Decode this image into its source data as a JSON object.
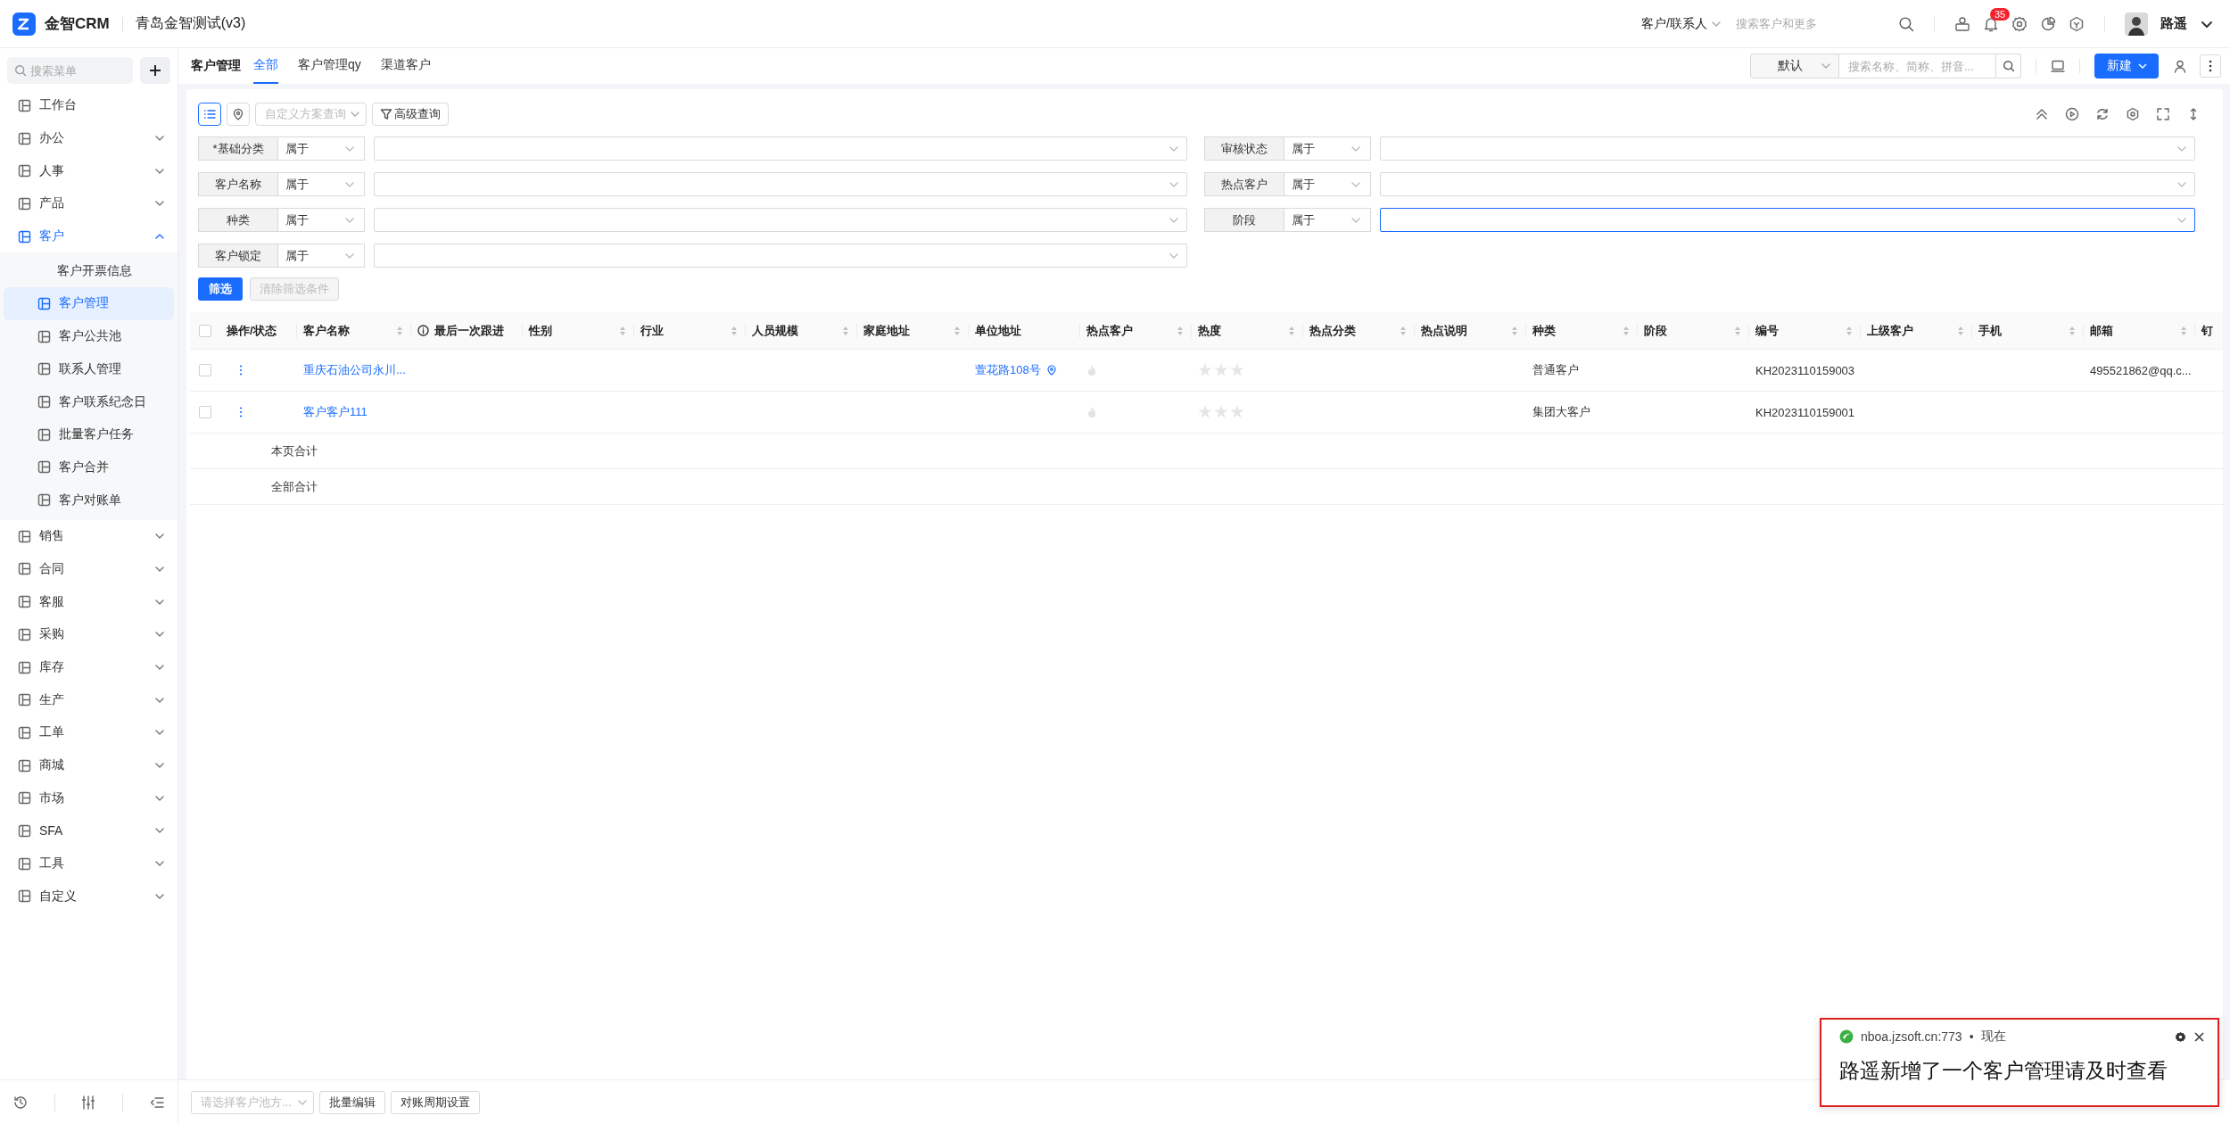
{
  "app": {
    "logo_text": "金智CRM",
    "org_name": "青岛金智测试(v3)"
  },
  "header": {
    "search_scope": "客户/联系人",
    "search_placeholder": "搜索客户和更多",
    "notification_count": "35",
    "user_name": "路遥"
  },
  "sidebar": {
    "search_placeholder": "搜索菜单",
    "items": [
      {
        "label": "工作台",
        "kind": "link",
        "selected": false
      },
      {
        "label": "办公",
        "kind": "group",
        "expanded": false,
        "selected": false
      },
      {
        "label": "人事",
        "kind": "group",
        "expanded": false,
        "selected": false
      },
      {
        "label": "产品",
        "kind": "group",
        "expanded": false,
        "selected": false
      },
      {
        "label": "客户",
        "kind": "group",
        "expanded": true,
        "selected": true,
        "children": [
          {
            "label": "客户开票信息",
            "kind": "plain",
            "selected": false
          },
          {
            "label": "客户管理",
            "kind": "page",
            "selected": true
          },
          {
            "label": "客户公共池",
            "kind": "page",
            "selected": false
          },
          {
            "label": "联系人管理",
            "kind": "page",
            "selected": false
          },
          {
            "label": "客户联系纪念日",
            "kind": "page",
            "selected": false
          },
          {
            "label": "批量客户任务",
            "kind": "page",
            "selected": false
          },
          {
            "label": "客户合并",
            "kind": "page",
            "selected": false
          },
          {
            "label": "客户对账单",
            "kind": "page",
            "selected": false
          }
        ]
      },
      {
        "label": "销售",
        "kind": "group",
        "expanded": false,
        "selected": false
      },
      {
        "label": "合同",
        "kind": "group",
        "expanded": false,
        "selected": false
      },
      {
        "label": "客服",
        "kind": "group",
        "expanded": false,
        "selected": false
      },
      {
        "label": "采购",
        "kind": "group",
        "expanded": false,
        "selected": false
      },
      {
        "label": "库存",
        "kind": "group",
        "expanded": false,
        "selected": false
      },
      {
        "label": "生产",
        "kind": "group",
        "expanded": false,
        "selected": false
      },
      {
        "label": "工单",
        "kind": "group",
        "expanded": false,
        "selected": false
      },
      {
        "label": "商城",
        "kind": "group",
        "expanded": false,
        "selected": false
      },
      {
        "label": "市场",
        "kind": "group",
        "expanded": false,
        "selected": false
      },
      {
        "label": "SFA",
        "kind": "group",
        "expanded": false,
        "selected": false
      },
      {
        "label": "工具",
        "kind": "group",
        "expanded": false,
        "selected": false
      },
      {
        "label": "自定义",
        "kind": "group",
        "expanded": false,
        "selected": false
      }
    ]
  },
  "page": {
    "title": "客户管理",
    "tabs": [
      {
        "label": "全部",
        "selected": true
      },
      {
        "label": "客户管理qy",
        "selected": false
      },
      {
        "label": "渠道客户",
        "selected": false
      }
    ],
    "view_select": "默认",
    "search_placeholder": "搜索名称、简称、拼音...",
    "new_button": "新建"
  },
  "toolbar": {
    "views": [
      {
        "kind": "list",
        "selected": true
      },
      {
        "kind": "map",
        "selected": false
      }
    ],
    "scheme_placeholder": "自定义方案查询",
    "advanced_button": "高级查询"
  },
  "filters": [
    {
      "label": "*基础分类",
      "operator": "属于",
      "focused": false
    },
    {
      "label": "审核状态",
      "operator": "属于",
      "focused": false
    },
    {
      "label": "客户名称",
      "operator": "属于",
      "focused": false
    },
    {
      "label": "热点客户",
      "operator": "属于",
      "focused": false
    },
    {
      "label": "种类",
      "operator": "属于",
      "focused": false
    },
    {
      "label": "阶段",
      "operator": "属于",
      "focused": true
    },
    {
      "label": "客户锁定",
      "operator": "属于",
      "focused": false
    }
  ],
  "filter_buttons": {
    "apply": "筛选",
    "clear": "清除筛选条件",
    "clear_disabled": true
  },
  "table": {
    "select_all_checked": false,
    "columns": [
      {
        "label": "操作/状态",
        "kind": "actions",
        "sortable": false
      },
      {
        "label": "客户名称",
        "kind": "name",
        "sortable": true
      },
      {
        "label": "最后一次跟进",
        "kind": "plain",
        "sortable": false,
        "info": true
      },
      {
        "label": "性别",
        "kind": "plain",
        "sortable": true
      },
      {
        "label": "行业",
        "kind": "plain",
        "sortable": true
      },
      {
        "label": "人员规模",
        "kind": "plain",
        "sortable": true
      },
      {
        "label": "家庭地址",
        "kind": "plain",
        "sortable": true
      },
      {
        "label": "单位地址",
        "kind": "address",
        "sortable": false
      },
      {
        "label": "热点客户",
        "kind": "hot",
        "sortable": true
      },
      {
        "label": "热度",
        "kind": "stars",
        "sortable": true
      },
      {
        "label": "热点分类",
        "kind": "plain",
        "sortable": true
      },
      {
        "label": "热点说明",
        "kind": "plain",
        "sortable": true
      },
      {
        "label": "种类",
        "kind": "type",
        "sortable": true
      },
      {
        "label": "阶段",
        "kind": "plain",
        "sortable": true
      },
      {
        "label": "编号",
        "kind": "code",
        "sortable": true
      },
      {
        "label": "上级客户",
        "kind": "plain",
        "sortable": true
      },
      {
        "label": "手机",
        "kind": "plain",
        "sortable": true
      },
      {
        "label": "邮箱",
        "kind": "email",
        "sortable": true
      },
      {
        "label": "钉",
        "kind": "plain"
      }
    ],
    "rows": [
      {
        "checked": false,
        "name": "重庆石油公司永川...",
        "address": "萱花路108号",
        "hot": false,
        "stars": 0,
        "type": "普通客户",
        "code": "KH2023110159003",
        "email": "495521862@qq.c..."
      },
      {
        "checked": false,
        "name": "客户客户111",
        "hot": false,
        "stars": 0,
        "type": "集团大客户",
        "code": "KH2023110159001"
      }
    ],
    "summary_rows": [
      "本页合计",
      "全部合计"
    ]
  },
  "bottom_bar": {
    "bulk_select_placeholder": "请选择客户池方...",
    "buttons": [
      "批量编辑",
      "对账周期设置"
    ]
  },
  "notification": {
    "source": "nboa.jzsoft.cn:773",
    "separator": "•",
    "time": "现在",
    "message": "路遥新增了一个客户管理请及时查看"
  }
}
